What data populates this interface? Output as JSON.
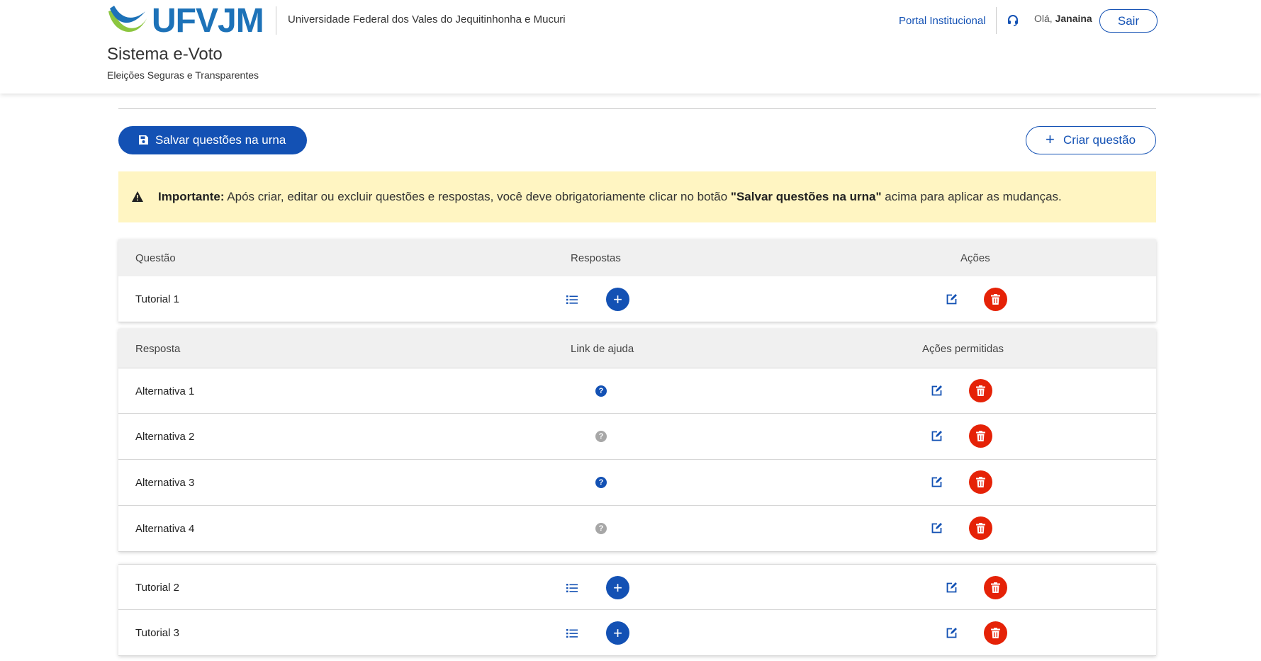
{
  "header": {
    "logo_text": "UFVJM",
    "university": "Universidade Federal dos Vales do Jequitinhonha e Mucuri",
    "system_title": "Sistema e-Voto",
    "system_subtitle": "Eleições Seguras e Transparentes",
    "portal_link": "Portal Institucional",
    "greeting_prefix": "Olá,",
    "user_name": "Janaina",
    "logout_label": "Sair"
  },
  "toolbar": {
    "save_label": "Salvar questões na urna",
    "create_label": "Criar questão",
    "create_icon": "plus-icon",
    "save_icon": "floppy-disk-icon"
  },
  "alert": {
    "icon": "warning-triangle-icon",
    "strong": "Importante:",
    "text_before": " Após criar, editar ou excluir questões e respostas, você deve obrigatoriamente clicar no botão ",
    "quoted": "\"Salvar questões na urna\"",
    "text_after": " acima para aplicar as mudanças."
  },
  "questions_table": {
    "headers": [
      "Questão",
      "Respostas",
      "Ações"
    ],
    "rows": [
      {
        "label": "Tutorial 1",
        "expanded": true
      },
      {
        "label": "Tutorial 2",
        "expanded": false
      },
      {
        "label": "Tutorial 3",
        "expanded": false
      }
    ]
  },
  "answers_table": {
    "headers": [
      "Resposta",
      "Link de ajuda",
      "Ações permitidas"
    ],
    "rows": [
      {
        "label": "Alternativa 1",
        "help_link": true
      },
      {
        "label": "Alternativa 2",
        "help_link": false
      },
      {
        "label": "Alternativa 3",
        "help_link": true
      },
      {
        "label": "Alternativa 4",
        "help_link": false
      }
    ]
  },
  "icons": {
    "list": "list-icon",
    "add": "plus-circle-icon",
    "edit": "edit-icon",
    "delete": "trash-icon",
    "help": "question-circle-icon",
    "support": "headset-icon"
  },
  "colors": {
    "primary": "#1351b4",
    "danger": "#e52207",
    "alert_bg": "#fff5c2",
    "logo_blue": "#1d72b8",
    "logo_green": "#8cc63f",
    "help_disabled": "#a7a7a7"
  },
  "help_glyph": "?"
}
